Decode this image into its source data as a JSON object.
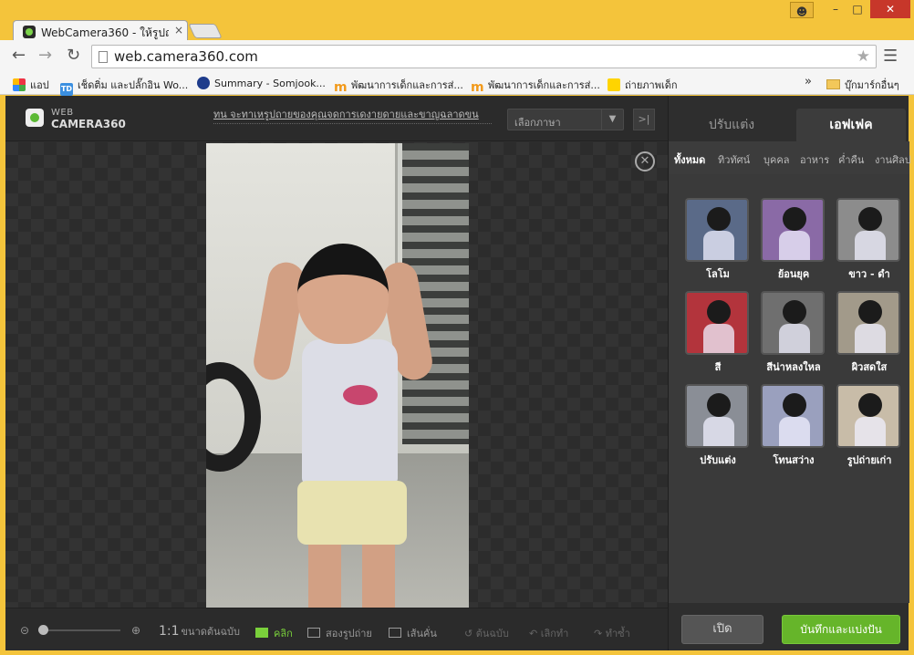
{
  "window": {
    "minimize": "–",
    "maximize": "□",
    "close": "✕"
  },
  "tab": {
    "title": "WebCamera360 - ให้รูปถ่าย",
    "close": "×"
  },
  "toolbar": {
    "url": "web.camera360.com"
  },
  "bookmarks": {
    "apps_label": "แอป",
    "items": [
      {
        "label": "เช็ดติ่ม และปลั๊กอิน Wo...",
        "icon": "td-icon"
      },
      {
        "label": "Summary - Somjook...",
        "icon": "summary-icon"
      },
      {
        "label": "พัฒนาการเด็กและการส่...",
        "icon": "m-icon"
      },
      {
        "label": "พัฒนาการเด็กและการส่...",
        "icon": "m-icon"
      },
      {
        "label": "ถ่ายภาพเด็ก",
        "icon": "nikon-icon"
      }
    ],
    "more": "»",
    "other_folder": "บุ๊กมาร์กอื่นๆ"
  },
  "app": {
    "logo_web": "WEB",
    "logo_camera": "CAMERA360",
    "marquee": "ทน จะทาเหรูปถายของคุณจดการเดงายดายและขาญฉลาดขน",
    "language_select": "เลือกภาษา",
    "collapse_glyph": ">|",
    "close_glyph": "✕"
  },
  "bottombar": {
    "zoom_out": "⊝",
    "zoom_in": "⊕",
    "actual_ratio": "1:1",
    "actual_label": "ขนาดต้นฉบับ",
    "click": "คลิก",
    "compare": "สองรูปถ่าย",
    "split": "เส้นคั่น",
    "undo": "ต้นฉบับ",
    "revert": "เลิกทำ",
    "redo": "ทำซ้ำ"
  },
  "panel": {
    "tab_adjust": "ปรับแต่ง",
    "tab_effects": "เอฟเฟค",
    "categories": [
      "ทั้งหมด",
      "ทิวทัศน์",
      "บุคคล",
      "อาหาร",
      "ค่ำคืน",
      "งานศิลป"
    ],
    "effects": [
      {
        "label": "โลโม",
        "tint": "#5a6a88"
      },
      {
        "label": "ย้อนยุค",
        "tint": "#8a6aa6"
      },
      {
        "label": "ขาว - ดำ",
        "tint": "#8c8c8c"
      },
      {
        "label": "สี",
        "tint": "#b3343c"
      },
      {
        "label": "สีน่าหลงใหล",
        "tint": "#6f6f6f"
      },
      {
        "label": "ผิวสดใส",
        "tint": "#a29a8a"
      },
      {
        "label": "ปรับแต่ง",
        "tint": "#8a8e96"
      },
      {
        "label": "โทนสว่าง",
        "tint": "#9aa0be"
      },
      {
        "label": "รูปถ่ายเก่า",
        "tint": "#c8bca8"
      }
    ],
    "open_button": "เปิด",
    "save_share_button": "บันทึกและแบ่งปัน"
  }
}
